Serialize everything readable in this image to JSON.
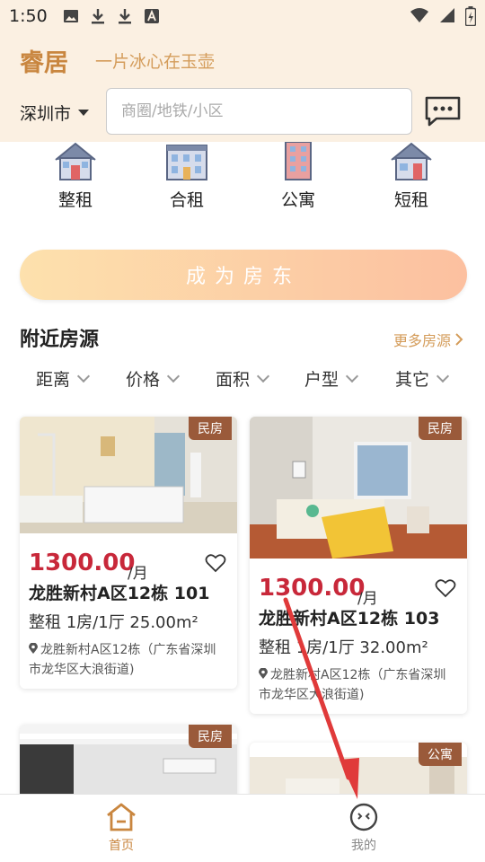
{
  "status_bar": {
    "time": "1:50",
    "icons": [
      "image-icon",
      "download-icon",
      "download-icon",
      "text-icon"
    ],
    "right_icons": [
      "wifi-icon",
      "signal-icon",
      "battery-icon"
    ]
  },
  "header": {
    "brand": "睿居",
    "slogan": "一片冰心在玉壶",
    "city": "深圳市",
    "search_placeholder": "商圈/地铁/小区",
    "accent_color": "#c9863f",
    "background_color": "#fbf0e2"
  },
  "categories": [
    {
      "label": "整租",
      "icon": "house-icon"
    },
    {
      "label": "合租",
      "icon": "building-icon"
    },
    {
      "label": "公寓",
      "icon": "apartment-icon"
    },
    {
      "label": "短租",
      "icon": "home-door-icon"
    }
  ],
  "landlord_button": "成为房东",
  "nearby": {
    "title": "附近房源",
    "more": "更多房源"
  },
  "filters": [
    "距离",
    "价格",
    "面积",
    "户型",
    "其它"
  ],
  "listings": [
    {
      "badge": "民房",
      "price": "1300.00",
      "unit": "/月",
      "name": "龙胜新村A区12栋  101",
      "spec": "整租  1房/1厅  25.00m²",
      "address": "龙胜新村A区12栋（广东省深圳市龙华区大浪街道)"
    },
    {
      "badge": "民房",
      "price": "1300.00",
      "unit": "/月",
      "name": "龙胜新村A区12栋  103",
      "spec": "整租  1房/1厅  32.00m²",
      "address": "龙胜新村A区12栋（广东省深圳市龙华区大浪街道)"
    },
    {
      "badge": "民房"
    },
    {
      "badge": "公寓"
    }
  ],
  "nav": {
    "home": "首页",
    "mine": "我的",
    "active_color": "#c9863f",
    "inactive_color": "#888888"
  },
  "price_color": "#c8283a"
}
